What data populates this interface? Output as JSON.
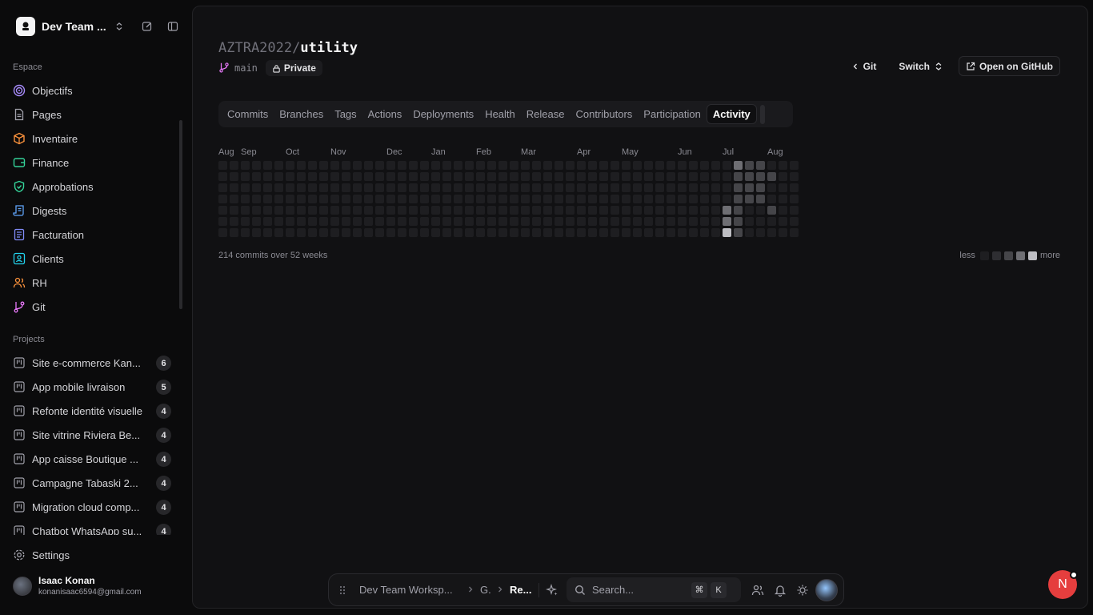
{
  "sidebar": {
    "workspace_name": "Dev Team ...",
    "espace_label": "Espace",
    "nav": [
      {
        "label": "Objectifs",
        "icon": "target-icon",
        "color": "#a78bfa"
      },
      {
        "label": "Pages",
        "icon": "file-icon",
        "color": "#a1a1aa"
      },
      {
        "label": "Inventaire",
        "icon": "box-icon",
        "color": "#fb923c"
      },
      {
        "label": "Finance",
        "icon": "wallet-icon",
        "color": "#34d399"
      },
      {
        "label": "Approbations",
        "icon": "shield-check-icon",
        "color": "#34d399"
      },
      {
        "label": "Digests",
        "icon": "scroll-icon",
        "color": "#60a5fa"
      },
      {
        "label": "Facturation",
        "icon": "receipt-icon",
        "color": "#818cf8"
      },
      {
        "label": "Clients",
        "icon": "contact-icon",
        "color": "#22d3ee"
      },
      {
        "label": "RH",
        "icon": "users-icon",
        "color": "#fb923c"
      },
      {
        "label": "Git",
        "icon": "git-branch-icon",
        "color": "#e879f9"
      }
    ],
    "projects_label": "Projects",
    "projects": [
      {
        "label": "Site e-commerce Kan...",
        "count": "6"
      },
      {
        "label": "App mobile livraison",
        "count": "5"
      },
      {
        "label": "Refonte identité visuelle",
        "count": "4"
      },
      {
        "label": "Site vitrine Riviera Be...",
        "count": "4"
      },
      {
        "label": "App caisse Boutique ...",
        "count": "4"
      },
      {
        "label": "Campagne Tabaski 2...",
        "count": "4"
      },
      {
        "label": "Migration cloud comp...",
        "count": "4"
      },
      {
        "label": "Chatbot WhatsApp su...",
        "count": "4"
      }
    ],
    "settings_label": "Settings",
    "user": {
      "name": "Isaac Konan",
      "email": "konanisaac6594@gmail.com"
    }
  },
  "repo": {
    "owner": "AZTRA2022/",
    "name": "utility",
    "branch": "main",
    "visibility": "Private"
  },
  "actions": {
    "back_label": "Git",
    "switch_label": "Switch",
    "github_label": "Open on GitHub"
  },
  "tabs": [
    "Commits",
    "Branches",
    "Tags",
    "Actions",
    "Deployments",
    "Health",
    "Release",
    "Contributors",
    "Participation",
    "Activity"
  ],
  "active_tab": "Activity",
  "activity": {
    "months": [
      "Aug",
      "Sep",
      "Oct",
      "Nov",
      "Dec",
      "Jan",
      "Feb",
      "Mar",
      "Apr",
      "May",
      "Jun",
      "Jul",
      "Aug"
    ],
    "weeks": 52,
    "summary": "214 commits over 52 weeks",
    "legend_less": "less",
    "legend_more": "more",
    "levels_colors": [
      "#1e1e21",
      "#2e2e32",
      "#454549",
      "#6e6e73",
      "#bdbdc2"
    ],
    "active_cells": [
      {
        "week": 45,
        "day": 4,
        "level": 3
      },
      {
        "week": 45,
        "day": 5,
        "level": 3
      },
      {
        "week": 45,
        "day": 6,
        "level": 4
      },
      {
        "week": 46,
        "day": 0,
        "level": 3
      },
      {
        "week": 46,
        "day": 1,
        "level": 2
      },
      {
        "week": 46,
        "day": 2,
        "level": 2
      },
      {
        "week": 46,
        "day": 3,
        "level": 2
      },
      {
        "week": 46,
        "day": 4,
        "level": 2
      },
      {
        "week": 46,
        "day": 5,
        "level": 2
      },
      {
        "week": 46,
        "day": 6,
        "level": 2
      },
      {
        "week": 47,
        "day": 0,
        "level": 2
      },
      {
        "week": 47,
        "day": 1,
        "level": 2
      },
      {
        "week": 47,
        "day": 2,
        "level": 2
      },
      {
        "week": 47,
        "day": 3,
        "level": 2
      },
      {
        "week": 48,
        "day": 0,
        "level": 2
      },
      {
        "week": 48,
        "day": 1,
        "level": 2
      },
      {
        "week": 48,
        "day": 2,
        "level": 2
      },
      {
        "week": 48,
        "day": 3,
        "level": 2
      },
      {
        "week": 49,
        "day": 1,
        "level": 2
      },
      {
        "week": 49,
        "day": 4,
        "level": 2
      }
    ]
  },
  "bottombar": {
    "workspace": "Dev Team Worksp...",
    "crumb1": "G.",
    "crumb2": "Re...",
    "search_placeholder": "Search...",
    "kbd_cmd": "⌘",
    "kbd_k": "K"
  },
  "fab_letter": "N"
}
